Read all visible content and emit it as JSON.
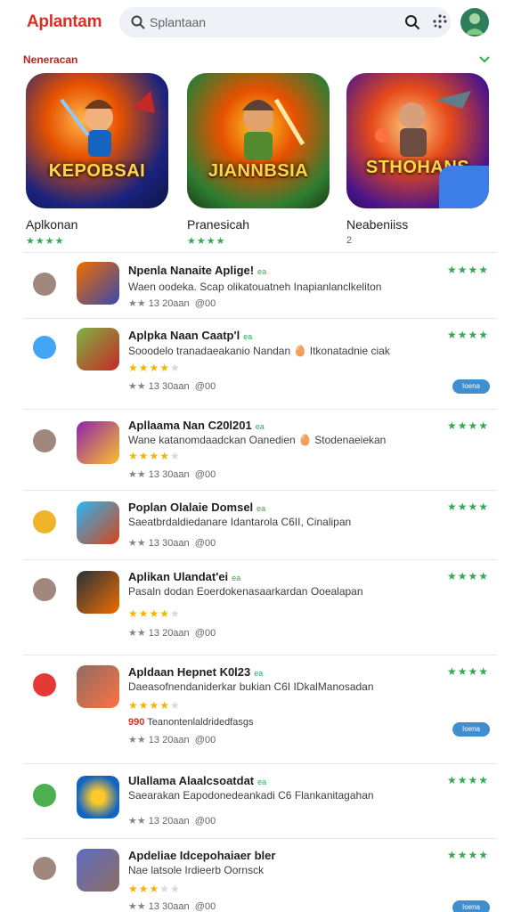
{
  "app": {
    "brand": "Aplantam"
  },
  "search": {
    "placeholder": "Splantaan"
  },
  "section": {
    "title": "Neneracan"
  },
  "featured": [
    {
      "art_title": "KEPOBSAI",
      "name": "Aplkonan",
      "sub": "★★★★"
    },
    {
      "art_title": "JIANNBSIA",
      "name": "Pranesicah",
      "sub": "★★★★"
    },
    {
      "art_title": "STHOHANS",
      "name": "Neabeniiss",
      "sub": "2"
    }
  ],
  "list": [
    {
      "title": "Npenla Nanaite Aplige!",
      "tag": "ea",
      "desc": "Waen oodeka. Scap olikatouatneh Inapianlanclkeliton",
      "stars": 0,
      "note": "",
      "meta": "13 20aan",
      "meta2": "@00",
      "rating": "★★★★",
      "pill": ""
    },
    {
      "title": "Aplpka Naan Caatp'l",
      "tag": "ea",
      "desc": "Sooodelo tranadaeakanio Nandan 🥚 Itkonatadnie ciak",
      "stars": 4.5,
      "note": "",
      "meta": "13 30aan",
      "meta2": "@00",
      "rating": "★★★★",
      "pill": "Ioena"
    },
    {
      "title": "Apllaama Nan C20l201",
      "tag": "ea",
      "desc": "Wane katanomdaadckan Oanedien 🥚 Stodenaeiekan",
      "stars": 4,
      "note": "",
      "meta": "13 30aan",
      "meta2": "@00",
      "rating": "★★★★",
      "pill": ""
    },
    {
      "title": "Poplan Olalaie Domsel",
      "tag": "ea",
      "desc": "Saeatbrdaldiedanare Idantarola C6II, Cinalipan",
      "stars": 0,
      "note": "",
      "meta": "13 30aan",
      "meta2": "@00",
      "rating": "★★★★",
      "pill": ""
    },
    {
      "title": "Aplikan Ulandat'ei",
      "tag": "ea",
      "desc": "Pasaln dodan Eoerdokenasaarkardan Ooealapan",
      "stars": 4,
      "note": "",
      "meta": "13 20aan",
      "meta2": "@00",
      "rating": "★★★★",
      "pill": ""
    },
    {
      "title": "Apldaan Hepnet K0l23",
      "tag": "ea",
      "desc": "Daeasofnendaniderkar bukian C6I IDkalManosadan",
      "stars": 4,
      "note": "Teanontenlaldridedfasgs",
      "note_red": "990",
      "meta": "13 20aan",
      "meta2": "@00",
      "rating": "★★★★",
      "pill": "Ioena"
    },
    {
      "title": "Ulallama Alaalcsoatdat",
      "tag": "ea",
      "desc": "Saearakan Eapodonedeankadi C6 Flankanitagahan",
      "stars": 0,
      "note": "",
      "meta": "13 20aan",
      "meta2": "@00",
      "rating": "★★★★",
      "pill": ""
    },
    {
      "title": "Apdeliae Idcepohaiaer bler",
      "tag": "",
      "desc": "Nae latsole Irdieerb Oornsck",
      "stars": 3.5,
      "note": "",
      "meta": "13 30aan",
      "meta2": "@00",
      "rating": "★★★★",
      "pill": "Ioena"
    }
  ],
  "colors": {
    "brand": "#d93025",
    "accent_green": "#34a853",
    "star": "#f4b400",
    "pill": "#3e8ed0"
  }
}
